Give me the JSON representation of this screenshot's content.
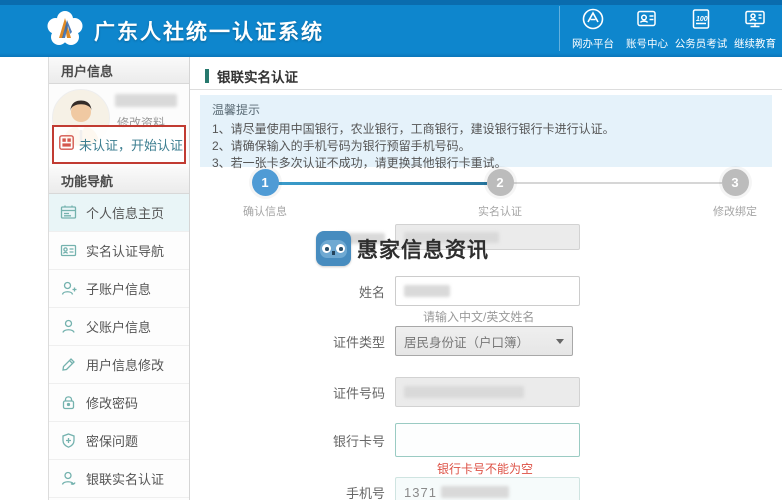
{
  "header": {
    "title": "广东人社统一认证系统",
    "nav": [
      {
        "label": "网办平台"
      },
      {
        "label": "账号中心"
      },
      {
        "label": "公务员考试"
      },
      {
        "label": "继续教育"
      }
    ]
  },
  "sidebar": {
    "user_section_title": "用户信息",
    "edit_profile_label": "修改资料",
    "cert_status_text": "未认证，开始认证",
    "nav_section_title": "功能导航",
    "menu": [
      {
        "label": "个人信息主页",
        "active": true
      },
      {
        "label": "实名认证导航",
        "active": false
      },
      {
        "label": "子账户信息",
        "active": false
      },
      {
        "label": "父账户信息",
        "active": false
      },
      {
        "label": "用户信息修改",
        "active": false
      },
      {
        "label": "修改密码",
        "active": false
      },
      {
        "label": "密保问题",
        "active": false
      },
      {
        "label": "银联实名认证",
        "active": false
      }
    ]
  },
  "main": {
    "page_title": "银联实名认证",
    "notice": {
      "title": "温馨提示",
      "items": [
        "1、请尽量使用中国银行，农业银行，工商银行，建设银行银行卡进行认证。",
        "2、请确保输入的手机号码为银行预留手机号码。",
        "3、若一张卡多次认证不成功，请更换其他银行卡重试。"
      ]
    },
    "steps": [
      {
        "num": "1",
        "label": "确认信息",
        "active": true
      },
      {
        "num": "2",
        "label": "实名认证",
        "active": false
      },
      {
        "num": "3",
        "label": "修改绑定",
        "active": false
      }
    ],
    "form": {
      "name_label": "姓名",
      "name_value_masked": true,
      "name_hint": "请输入中文/英文姓名",
      "id_type_label": "证件类型",
      "id_type_value": "居民身份证（户口簿）",
      "id_number_label": "证件号码",
      "id_number_value_masked": true,
      "bank_card_label": "银行卡号",
      "bank_card_value": "",
      "bank_card_error": "银行卡号不能为空",
      "phone_label": "手机号",
      "phone_value_visible": "1371",
      "phone_value_masked": true
    },
    "watermark_text": "惠家信息资讯",
    "colors": {
      "header_blue": "#0e86cd",
      "accent_teal": "#27796e",
      "active_step_blue": "#4f9bd5",
      "alert_red_border": "#c13b32",
      "error_red": "#dd5145",
      "notice_bg": "#e5f2fa"
    }
  }
}
